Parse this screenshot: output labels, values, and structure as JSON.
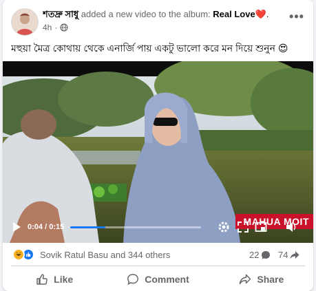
{
  "post": {
    "author": "শতদ্রু সাধু",
    "action_text": " added a new video to the album: ",
    "album": "Real Love",
    "album_heart": "❤️",
    "album_trail": ".",
    "timestamp": "4h",
    "separator": "·",
    "privacy_icon": "globe-icon",
    "more_label": "•••"
  },
  "caption": {
    "text": "মহুয়া মৈত্র কোথায় থেকে এনার্জি পায় একটু ভালো করে মন দিয়ে শুনুন 😍"
  },
  "video": {
    "overlay_text": "MAHUA MOIT",
    "current_time": "0:04",
    "time_sep": " / ",
    "duration": "0:15",
    "progress_fraction": 0.27
  },
  "reactions": {
    "types": [
      "haha",
      "like"
    ],
    "summary": "Sovik Ratul Basu and 344 others",
    "comments_count": "22",
    "shares_count": "74"
  },
  "actions": {
    "like": "Like",
    "comment": "Comment",
    "share": "Share"
  },
  "colors": {
    "accent": "#1877f2",
    "overlay_red": "#c9122a",
    "muted_text": "#65676b"
  }
}
